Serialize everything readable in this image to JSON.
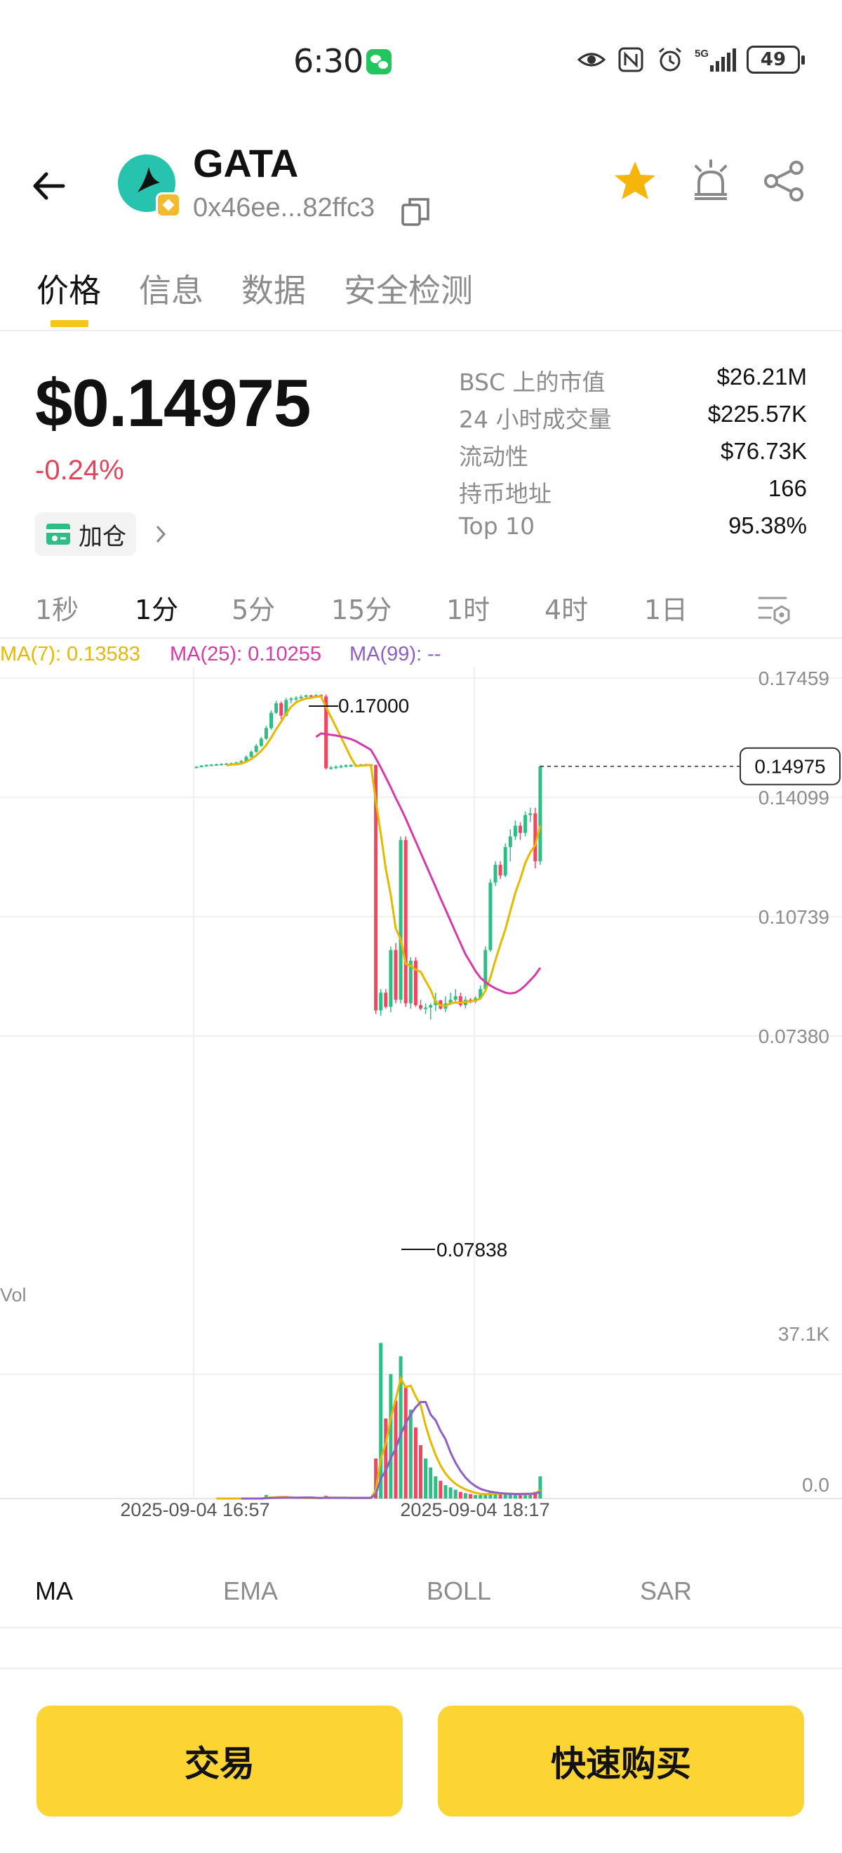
{
  "status_bar": {
    "time": "6:30",
    "battery": "49",
    "icons": [
      "wechat-icon",
      "eye-icon",
      "nfc-icon",
      "alarm-icon",
      "signal-5g-icon",
      "battery-icon"
    ]
  },
  "header": {
    "token_name": "GATA",
    "address": "0x46ee...82ffc3",
    "icons": [
      "back-arrow-icon",
      "copy-icon",
      "star-icon",
      "alert-bell-icon",
      "share-icon"
    ],
    "star_color": "#f5b50a"
  },
  "main_tabs": [
    {
      "label": "价格",
      "active": true
    },
    {
      "label": "信息",
      "active": false
    },
    {
      "label": "数据",
      "active": false
    },
    {
      "label": "安全检测",
      "active": false
    }
  ],
  "price": {
    "value": "$0.14975",
    "change": "-0.24%",
    "change_color": "#e0455c",
    "add_position_label": "加仓"
  },
  "stats": [
    {
      "label": "BSC 上的市值",
      "value": "$26.21M"
    },
    {
      "label": "24 小时成交量",
      "value": "$225.57K"
    },
    {
      "label": "流动性",
      "value": "$76.73K"
    },
    {
      "label": "持币地址",
      "value": "166"
    },
    {
      "label": "Top 10",
      "value": "95.38%"
    }
  ],
  "timeframes": [
    {
      "label": "1秒",
      "active": false
    },
    {
      "label": "1分",
      "active": true
    },
    {
      "label": "5分",
      "active": false
    },
    {
      "label": "15分",
      "active": false
    },
    {
      "label": "1时",
      "active": false
    },
    {
      "label": "4时",
      "active": false
    },
    {
      "label": "1日",
      "active": false
    }
  ],
  "ma_legend": [
    {
      "label": "MA(7): 0.13583",
      "color": "#e6b800"
    },
    {
      "label": "MA(25): 0.10255",
      "color": "#d63aa8"
    },
    {
      "label": "MA(99): --",
      "color": "#8e5fc9"
    }
  ],
  "chart_data": {
    "type": "candlestick",
    "price_ticks": [
      "0.17459",
      "0.14099",
      "0.10739",
      "0.07380"
    ],
    "yaxis_ticks": [
      0.17459,
      0.14099,
      0.10739,
      0.0738
    ],
    "high_label": "0.17000",
    "low_label": "0.07838",
    "current_price_label": "0.14975",
    "current_price": 0.14975,
    "volume_label": "Vol",
    "volume_ticks": [
      "37.1K",
      "0.0"
    ],
    "volume_max": 37100,
    "x_ticks": [
      "2025-09-04 16:57",
      "2025-09-04 18:17"
    ],
    "up_color": "#2ebd85",
    "down_color": "#f0465e",
    "candles": [
      {
        "o": 0.1495,
        "h": 0.1498,
        "l": 0.1492,
        "c": 0.1496,
        "v": 0
      },
      {
        "o": 0.1496,
        "h": 0.1501,
        "l": 0.1494,
        "c": 0.1499,
        "v": 0
      },
      {
        "o": 0.1499,
        "h": 0.1503,
        "l": 0.1497,
        "c": 0.1501,
        "v": 0
      },
      {
        "o": 0.1501,
        "h": 0.1504,
        "l": 0.1499,
        "c": 0.1502,
        "v": 0
      },
      {
        "o": 0.1502,
        "h": 0.1505,
        "l": 0.15,
        "c": 0.1503,
        "v": 0
      },
      {
        "o": 0.1503,
        "h": 0.1506,
        "l": 0.1501,
        "c": 0.1504,
        "v": 0
      },
      {
        "o": 0.1504,
        "h": 0.1507,
        "l": 0.1502,
        "c": 0.1505,
        "v": 0
      },
      {
        "o": 0.1505,
        "h": 0.1508,
        "l": 0.1503,
        "c": 0.1506,
        "v": 0
      },
      {
        "o": 0.1506,
        "h": 0.151,
        "l": 0.1504,
        "c": 0.1508,
        "v": 0
      },
      {
        "o": 0.1508,
        "h": 0.1515,
        "l": 0.1506,
        "c": 0.1512,
        "v": 0
      },
      {
        "o": 0.1512,
        "h": 0.1528,
        "l": 0.151,
        "c": 0.1524,
        "v": 0
      },
      {
        "o": 0.1524,
        "h": 0.1542,
        "l": 0.1521,
        "c": 0.1538,
        "v": 0
      },
      {
        "o": 0.1538,
        "h": 0.156,
        "l": 0.1535,
        "c": 0.1555,
        "v": 0
      },
      {
        "o": 0.1555,
        "h": 0.158,
        "l": 0.1552,
        "c": 0.1575,
        "v": 0
      },
      {
        "o": 0.1575,
        "h": 0.1612,
        "l": 0.1572,
        "c": 0.1605,
        "v": 800
      },
      {
        "o": 0.1605,
        "h": 0.1655,
        "l": 0.16,
        "c": 0.1648,
        "v": 400
      },
      {
        "o": 0.1648,
        "h": 0.1682,
        "l": 0.1644,
        "c": 0.1675,
        "v": 300
      },
      {
        "o": 0.1675,
        "h": 0.168,
        "l": 0.163,
        "c": 0.164,
        "v": 200
      },
      {
        "o": 0.164,
        "h": 0.169,
        "l": 0.1638,
        "c": 0.1684,
        "v": 200
      },
      {
        "o": 0.1684,
        "h": 0.1692,
        "l": 0.1675,
        "c": 0.1688,
        "v": 100
      },
      {
        "o": 0.1688,
        "h": 0.1695,
        "l": 0.168,
        "c": 0.169,
        "v": 100
      },
      {
        "o": 0.169,
        "h": 0.1698,
        "l": 0.1686,
        "c": 0.1693,
        "v": 100
      },
      {
        "o": 0.1693,
        "h": 0.1699,
        "l": 0.1689,
        "c": 0.1697,
        "v": 100
      },
      {
        "o": 0.1697,
        "h": 0.1699,
        "l": 0.1692,
        "c": 0.1695,
        "v": 100
      },
      {
        "o": 0.1695,
        "h": 0.17,
        "l": 0.169,
        "c": 0.1698,
        "v": 100
      },
      {
        "o": 0.1698,
        "h": 0.17,
        "l": 0.1692,
        "c": 0.1694,
        "v": 100
      },
      {
        "o": 0.1694,
        "h": 0.17,
        "l": 0.1488,
        "c": 0.1492,
        "v": 600
      },
      {
        "o": 0.1492,
        "h": 0.1498,
        "l": 0.1488,
        "c": 0.1494,
        "v": 100
      },
      {
        "o": 0.1494,
        "h": 0.15,
        "l": 0.149,
        "c": 0.1496,
        "v": 100
      },
      {
        "o": 0.1496,
        "h": 0.1502,
        "l": 0.1492,
        "c": 0.1498,
        "v": 100
      },
      {
        "o": 0.1498,
        "h": 0.1503,
        "l": 0.1494,
        "c": 0.15,
        "v": 100
      },
      {
        "o": 0.15,
        "h": 0.1503,
        "l": 0.1495,
        "c": 0.1501,
        "v": 100
      },
      {
        "o": 0.1501,
        "h": 0.1504,
        "l": 0.1497,
        "c": 0.1502,
        "v": 100
      },
      {
        "o": 0.1502,
        "h": 0.1504,
        "l": 0.1499,
        "c": 0.1503,
        "v": 100
      },
      {
        "o": 0.1503,
        "h": 0.1505,
        "l": 0.15,
        "c": 0.1502,
        "v": 100
      },
      {
        "o": 0.1502,
        "h": 0.1504,
        "l": 0.1498,
        "c": 0.1501,
        "v": 100
      },
      {
        "o": 0.1501,
        "h": 0.1502,
        "l": 0.08,
        "c": 0.081,
        "v": 9000
      },
      {
        "o": 0.081,
        "h": 0.087,
        "l": 0.0795,
        "c": 0.086,
        "v": 35000
      },
      {
        "o": 0.086,
        "h": 0.087,
        "l": 0.0815,
        "c": 0.082,
        "v": 18000
      },
      {
        "o": 0.082,
        "h": 0.099,
        "l": 0.0805,
        "c": 0.098,
        "v": 28000
      },
      {
        "o": 0.098,
        "h": 0.1,
        "l": 0.083,
        "c": 0.084,
        "v": 22000
      },
      {
        "o": 0.084,
        "h": 0.13,
        "l": 0.083,
        "c": 0.129,
        "v": 32000
      },
      {
        "o": 0.129,
        "h": 0.13,
        "l": 0.082,
        "c": 0.083,
        "v": 25000
      },
      {
        "o": 0.083,
        "h": 0.096,
        "l": 0.0815,
        "c": 0.095,
        "v": 20000
      },
      {
        "o": 0.095,
        "h": 0.096,
        "l": 0.082,
        "c": 0.0825,
        "v": 16000
      },
      {
        "o": 0.0825,
        "h": 0.084,
        "l": 0.081,
        "c": 0.0815,
        "v": 12000
      },
      {
        "o": 0.0815,
        "h": 0.083,
        "l": 0.08,
        "c": 0.0818,
        "v": 9000
      },
      {
        "o": 0.0818,
        "h": 0.083,
        "l": 0.0784,
        "c": 0.0825,
        "v": 7000
      },
      {
        "o": 0.0825,
        "h": 0.086,
        "l": 0.0808,
        "c": 0.0838,
        "v": 5000
      },
      {
        "o": 0.0838,
        "h": 0.084,
        "l": 0.0812,
        "c": 0.0815,
        "v": 4000
      },
      {
        "o": 0.0815,
        "h": 0.085,
        "l": 0.0805,
        "c": 0.083,
        "v": 3000
      },
      {
        "o": 0.083,
        "h": 0.086,
        "l": 0.0825,
        "c": 0.084,
        "v": 2500
      },
      {
        "o": 0.084,
        "h": 0.087,
        "l": 0.083,
        "c": 0.085,
        "v": 2000
      },
      {
        "o": 0.085,
        "h": 0.086,
        "l": 0.082,
        "c": 0.0825,
        "v": 1500
      },
      {
        "o": 0.0825,
        "h": 0.085,
        "l": 0.0815,
        "c": 0.084,
        "v": 1200
      },
      {
        "o": 0.084,
        "h": 0.0845,
        "l": 0.083,
        "c": 0.0835,
        "v": 1000
      },
      {
        "o": 0.0835,
        "h": 0.085,
        "l": 0.083,
        "c": 0.0845,
        "v": 800
      },
      {
        "o": 0.0845,
        "h": 0.088,
        "l": 0.084,
        "c": 0.087,
        "v": 800
      },
      {
        "o": 0.087,
        "h": 0.099,
        "l": 0.0865,
        "c": 0.098,
        "v": 1200
      },
      {
        "o": 0.098,
        "h": 0.118,
        "l": 0.0975,
        "c": 0.117,
        "v": 1500
      },
      {
        "o": 0.117,
        "h": 0.123,
        "l": 0.116,
        "c": 0.122,
        "v": 1200
      },
      {
        "o": 0.122,
        "h": 0.123,
        "l": 0.118,
        "c": 0.119,
        "v": 900
      },
      {
        "o": 0.119,
        "h": 0.128,
        "l": 0.1185,
        "c": 0.127,
        "v": 900
      },
      {
        "o": 0.127,
        "h": 0.132,
        "l": 0.123,
        "c": 0.13,
        "v": 1000
      },
      {
        "o": 0.13,
        "h": 0.1345,
        "l": 0.129,
        "c": 0.133,
        "v": 1000
      },
      {
        "o": 0.133,
        "h": 0.134,
        "l": 0.129,
        "c": 0.131,
        "v": 900
      },
      {
        "o": 0.131,
        "h": 0.137,
        "l": 0.13,
        "c": 0.136,
        "v": 1200
      },
      {
        "o": 0.136,
        "h": 0.138,
        "l": 0.134,
        "c": 0.1365,
        "v": 1000
      },
      {
        "o": 0.1365,
        "h": 0.138,
        "l": 0.121,
        "c": 0.123,
        "v": 1500
      },
      {
        "o": 0.123,
        "h": 0.15,
        "l": 0.122,
        "c": 0.1497,
        "v": 5000
      }
    ],
    "ma7": [
      null,
      null,
      null,
      null,
      null,
      null,
      0.15,
      0.1502,
      0.1503,
      0.1505,
      0.151,
      0.1518,
      0.1528,
      0.1541,
      0.1557,
      0.1578,
      0.1602,
      0.1623,
      0.1645,
      0.1665,
      0.1677,
      0.1684,
      0.1688,
      0.169,
      0.1693,
      0.1694,
      0.1664,
      0.1636,
      0.1608,
      0.158,
      0.1551,
      0.1522,
      0.1498,
      0.1499,
      0.15,
      0.1501,
      0.14,
      0.1307,
      0.1209,
      0.1135,
      0.1041,
      0.101,
      0.0941,
      0.0936,
      0.0925,
      0.0919,
      0.0893,
      0.0868,
      0.0834,
      0.0824,
      0.0823,
      0.083,
      0.0832,
      0.0832,
      0.0834,
      0.0835,
      0.0838,
      0.0843,
      0.0865,
      0.0903,
      0.0951,
      0.0996,
      0.1038,
      0.109,
      0.1141,
      0.118,
      0.1225,
      0.1255,
      0.1275,
      0.133
    ],
    "ma25": [
      null,
      null,
      null,
      null,
      null,
      null,
      null,
      null,
      null,
      null,
      null,
      null,
      null,
      null,
      null,
      null,
      null,
      null,
      null,
      null,
      null,
      null,
      null,
      null,
      0.158,
      0.159,
      0.1588,
      0.1586,
      0.1584,
      0.1581,
      0.1578,
      0.1574,
      0.1568,
      0.156,
      0.1552,
      0.1544,
      0.152,
      0.1494,
      0.1466,
      0.1438,
      0.1408,
      0.138,
      0.135,
      0.1318,
      0.1286,
      0.1254,
      0.1222,
      0.119,
      0.1158,
      0.1125,
      0.1094,
      0.1062,
      0.103,
      0.0999,
      0.0968,
      0.0945,
      0.0921,
      0.0902,
      0.089,
      0.088,
      0.0872,
      0.0866,
      0.086,
      0.0858,
      0.086,
      0.0868,
      0.088,
      0.0895,
      0.091,
      0.093
    ]
  },
  "indicator_tabs": [
    {
      "label": "MA",
      "active": true
    },
    {
      "label": "EMA",
      "active": false
    },
    {
      "label": "BOLL",
      "active": false
    },
    {
      "label": "SAR",
      "active": false
    }
  ],
  "buttons": {
    "trade": "交易",
    "quick_buy": "快速购买"
  }
}
